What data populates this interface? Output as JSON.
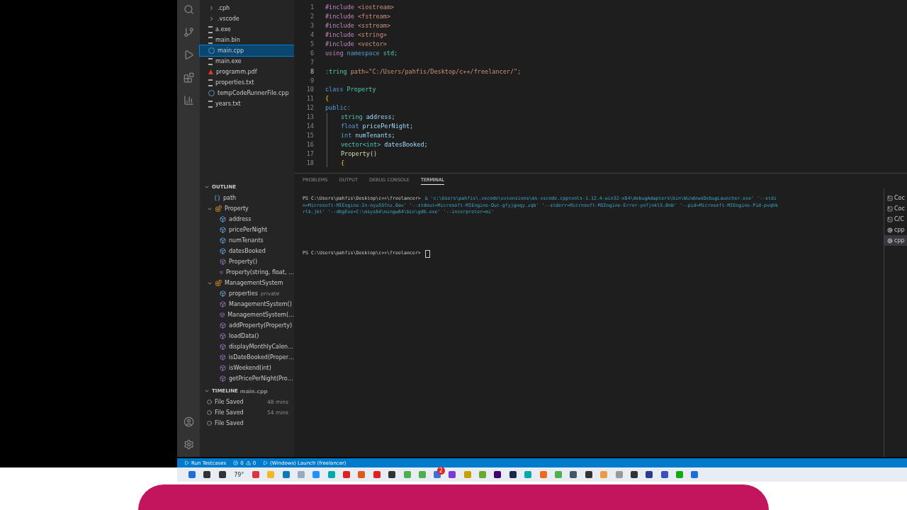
{
  "explorer": {
    "items": [
      {
        "label": ".cph",
        "kind": "folder"
      },
      {
        "label": ".vscode",
        "kind": "folder"
      },
      {
        "label": "a.exe",
        "kind": "file",
        "selected": false
      },
      {
        "label": "main.bin",
        "kind": "file",
        "selected": false
      },
      {
        "label": "main.cpp",
        "kind": "cpp",
        "selected": true
      },
      {
        "label": "main.exe",
        "kind": "file",
        "selected": false
      },
      {
        "label": "programm.pdf",
        "kind": "pdf",
        "selected": false
      },
      {
        "label": "properties.txt",
        "kind": "file",
        "selected": false
      },
      {
        "label": "tempCodeRunnerFile.cpp",
        "kind": "cpp",
        "selected": false
      },
      {
        "label": "years.txt",
        "kind": "file",
        "selected": false
      }
    ]
  },
  "outline": {
    "title": "OUTLINE",
    "items": [
      {
        "label": "path",
        "kind": "variable"
      },
      {
        "label": "Property",
        "kind": "class",
        "expanded": true,
        "children": [
          {
            "label": "address",
            "kind": "field"
          },
          {
            "label": "pricePerNight",
            "kind": "field"
          },
          {
            "label": "numTenants",
            "kind": "field"
          },
          {
            "label": "datesBooked",
            "kind": "field"
          },
          {
            "label": "Property()",
            "kind": "method"
          },
          {
            "label": "Property(string, float, …",
            "kind": "method"
          }
        ]
      },
      {
        "label": "ManagementSystem",
        "kind": "class",
        "expanded": true,
        "children": [
          {
            "label": "properties",
            "kind": "field",
            "detail": "private"
          },
          {
            "label": "ManagementSystem()",
            "kind": "method"
          },
          {
            "label": "ManagementSystem(…",
            "kind": "method"
          },
          {
            "label": "addProperty(Property)",
            "kind": "method"
          },
          {
            "label": "loadData()",
            "kind": "method"
          },
          {
            "label": "displayMonthlyCalen…",
            "kind": "method"
          },
          {
            "label": "isDateBooked(Proper…",
            "kind": "method"
          },
          {
            "label": "isWeekend(int)",
            "kind": "method"
          },
          {
            "label": "getPricePerNight(Pro…",
            "kind": "method"
          }
        ]
      }
    ]
  },
  "timeline": {
    "title": "TIMELINE",
    "file": "main.cpp",
    "items": [
      {
        "label": "File Saved",
        "time": "48 mins"
      },
      {
        "label": "File Saved",
        "time": "54 mins"
      },
      {
        "label": "File Saved"
      }
    ]
  },
  "editor": {
    "lines": [
      {
        "number": "1",
        "current": false,
        "indented": false,
        "tokens": [
          {
            "text": "#include",
            "kind": "directive"
          },
          {
            "text": "<iostream>",
            "kind": "string"
          }
        ]
      },
      {
        "number": "2",
        "current": false,
        "indented": false,
        "tokens": [
          {
            "text": "#include",
            "kind": "directive"
          },
          {
            "text": "<fstream>",
            "kind": "string"
          }
        ]
      },
      {
        "number": "3",
        "current": false,
        "indented": false,
        "tokens": [
          {
            "text": "#include",
            "kind": "directive"
          },
          {
            "text": "<sstream>",
            "kind": "string"
          }
        ]
      },
      {
        "number": "4",
        "current": false,
        "indented": false,
        "tokens": [
          {
            "text": "#include",
            "kind": "directive"
          },
          {
            "text": "<string>",
            "kind": "string"
          }
        ]
      },
      {
        "number": "5",
        "current": false,
        "indented": false,
        "tokens": [
          {
            "text": "#include",
            "kind": "directive"
          },
          {
            "text": "<vector>",
            "kind": "string"
          }
        ]
      },
      {
        "number": "6",
        "current": false,
        "indented": false,
        "tokens": [
          {
            "text": "using",
            "kind": "directive"
          },
          {
            "text": "namespace",
            "kind": "keyword"
          },
          {
            "text": "std;",
            "kind": "type"
          }
        ]
      },
      {
        "number": "7",
        "current": false,
        "indented": false
      },
      {
        "number": "8",
        "current": true,
        "indented": false,
        "tokens": [
          {
            "text": ":tring",
            "kind": "type"
          },
          {
            "text": "path=\"C:/Users/pahfis/Desktop/c++/freelancer/\";",
            "kind": "string"
          }
        ]
      },
      {
        "number": "9",
        "current": false,
        "indented": false
      },
      {
        "number": "10",
        "current": false,
        "indented": false,
        "tokens": [
          {
            "text": "class",
            "kind": "keyword"
          },
          {
            "text": "Property",
            "kind": "type"
          }
        ]
      },
      {
        "number": "11",
        "current": false,
        "indented": false,
        "tokens": [
          {
            "text": "{",
            "kind": "bracket"
          }
        ]
      },
      {
        "number": "12",
        "current": false,
        "indented": false,
        "tokens": [
          {
            "text": "public:",
            "kind": "keyword"
          }
        ]
      },
      {
        "number": "13",
        "current": false,
        "indented": true,
        "tokens": [
          {
            "text": "string",
            "kind": "type"
          },
          {
            "text": "address;",
            "kind": "ident"
          }
        ]
      },
      {
        "number": "14",
        "current": false,
        "indented": true,
        "tokens": [
          {
            "text": "float",
            "kind": "keyword"
          },
          {
            "text": "pricePerNight;",
            "kind": "ident"
          }
        ]
      },
      {
        "number": "15",
        "current": false,
        "indented": true,
        "tokens": [
          {
            "text": "int",
            "kind": "keyword"
          },
          {
            "text": "numTenants;",
            "kind": "ident"
          }
        ]
      },
      {
        "number": "16",
        "current": false,
        "indented": true,
        "tokens": [
          {
            "text": "vector<int>",
            "kind": "type"
          },
          {
            "text": "datesBooked;",
            "kind": "ident"
          }
        ]
      },
      {
        "number": "17",
        "current": false,
        "indented": true,
        "tokens": [
          {
            "text": "Property()",
            "kind": "func"
          }
        ]
      },
      {
        "number": "18",
        "current": false,
        "indented": true,
        "tokens": [
          {
            "text": "{",
            "kind": "bracket"
          }
        ]
      }
    ]
  },
  "panel": {
    "tabs": [
      {
        "label": "PROBLEMS",
        "selected": false
      },
      {
        "label": "OUTPUT",
        "selected": false
      },
      {
        "label": "DEBUG CONSOLE",
        "selected": false
      },
      {
        "label": "TERMINAL",
        "selected": true
      }
    ],
    "terminal": [
      {
        "prompt": "PS C:\\Users\\pahfis\\Desktop\\c++\\freelancer>",
        "command": "& 'c:\\Users\\pahfis\\.vscode\\extensions\\ms-vscode.cpptools-1.12.4-win32-x64\\debugAdapters\\bin\\WindowsDebugLauncher.exe' '--stdi"
      },
      {
        "command": "n=Microsoft-MIEngine-In-oyu55fnz.0av' '--stdout=Microsoft-MIEngine-Out-gfyjgoqy.zqb' '--stderr=Microsoft-MIEngine-Error-yofjnkl5.0nb' '--pid=Microsoft-MIEngine-Pid-pvqhk"
      },
      {
        "command": "rlk.jbt' '--dbgExe=C:\\msys64\\mingw64\\bin\\gdb.exe' '--interpreter=mi'"
      },
      {
        "prompt": "PS C:\\Users\\pahfis\\Desktop\\c++\\freelancer>",
        "cursor": true
      }
    ],
    "sessions": [
      {
        "label": "Coc",
        "kind": "terminal",
        "selected": false
      },
      {
        "label": "Coc",
        "kind": "terminal",
        "selected": false
      },
      {
        "label": "C/C",
        "kind": "terminal",
        "selected": false
      },
      {
        "label": "cpp",
        "kind": "debug",
        "selected": false
      },
      {
        "label": "cpp",
        "kind": "debug",
        "selected": true
      }
    ]
  },
  "status_bar": {
    "run": "Run Testcases",
    "errors": "0",
    "warnings": "0",
    "launch": "(Windows) Launch (freelancer)"
  },
  "taskbar": {
    "weather": "79°",
    "badge": "2"
  }
}
